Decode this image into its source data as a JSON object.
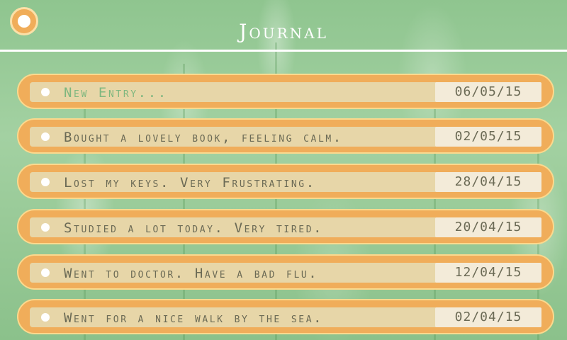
{
  "header": {
    "title": "Journal",
    "menu_icon": "circle-menu-icon"
  },
  "entries": [
    {
      "text": "New Entry...",
      "date": "06/05/15"
    },
    {
      "text": "Bought a lovely book, feeling calm.",
      "date": "02/05/15"
    },
    {
      "text": "Lost my keys. Very Frustrating.",
      "date": "28/04/15"
    },
    {
      "text": "Studied a lot today. Very tired.",
      "date": "20/04/15"
    },
    {
      "text": "Went to doctor. Have a bad flu.",
      "date": "12/04/15"
    },
    {
      "text": "Went for a nice walk by the sea.",
      "date": "02/04/15"
    }
  ],
  "colors": {
    "background": "#93c793",
    "accent": "#f0ad5a",
    "field": "#e7d6a8",
    "date_field": "#f3ebd9",
    "text": "#6b6a55",
    "new_entry_text": "#7fb77f"
  }
}
